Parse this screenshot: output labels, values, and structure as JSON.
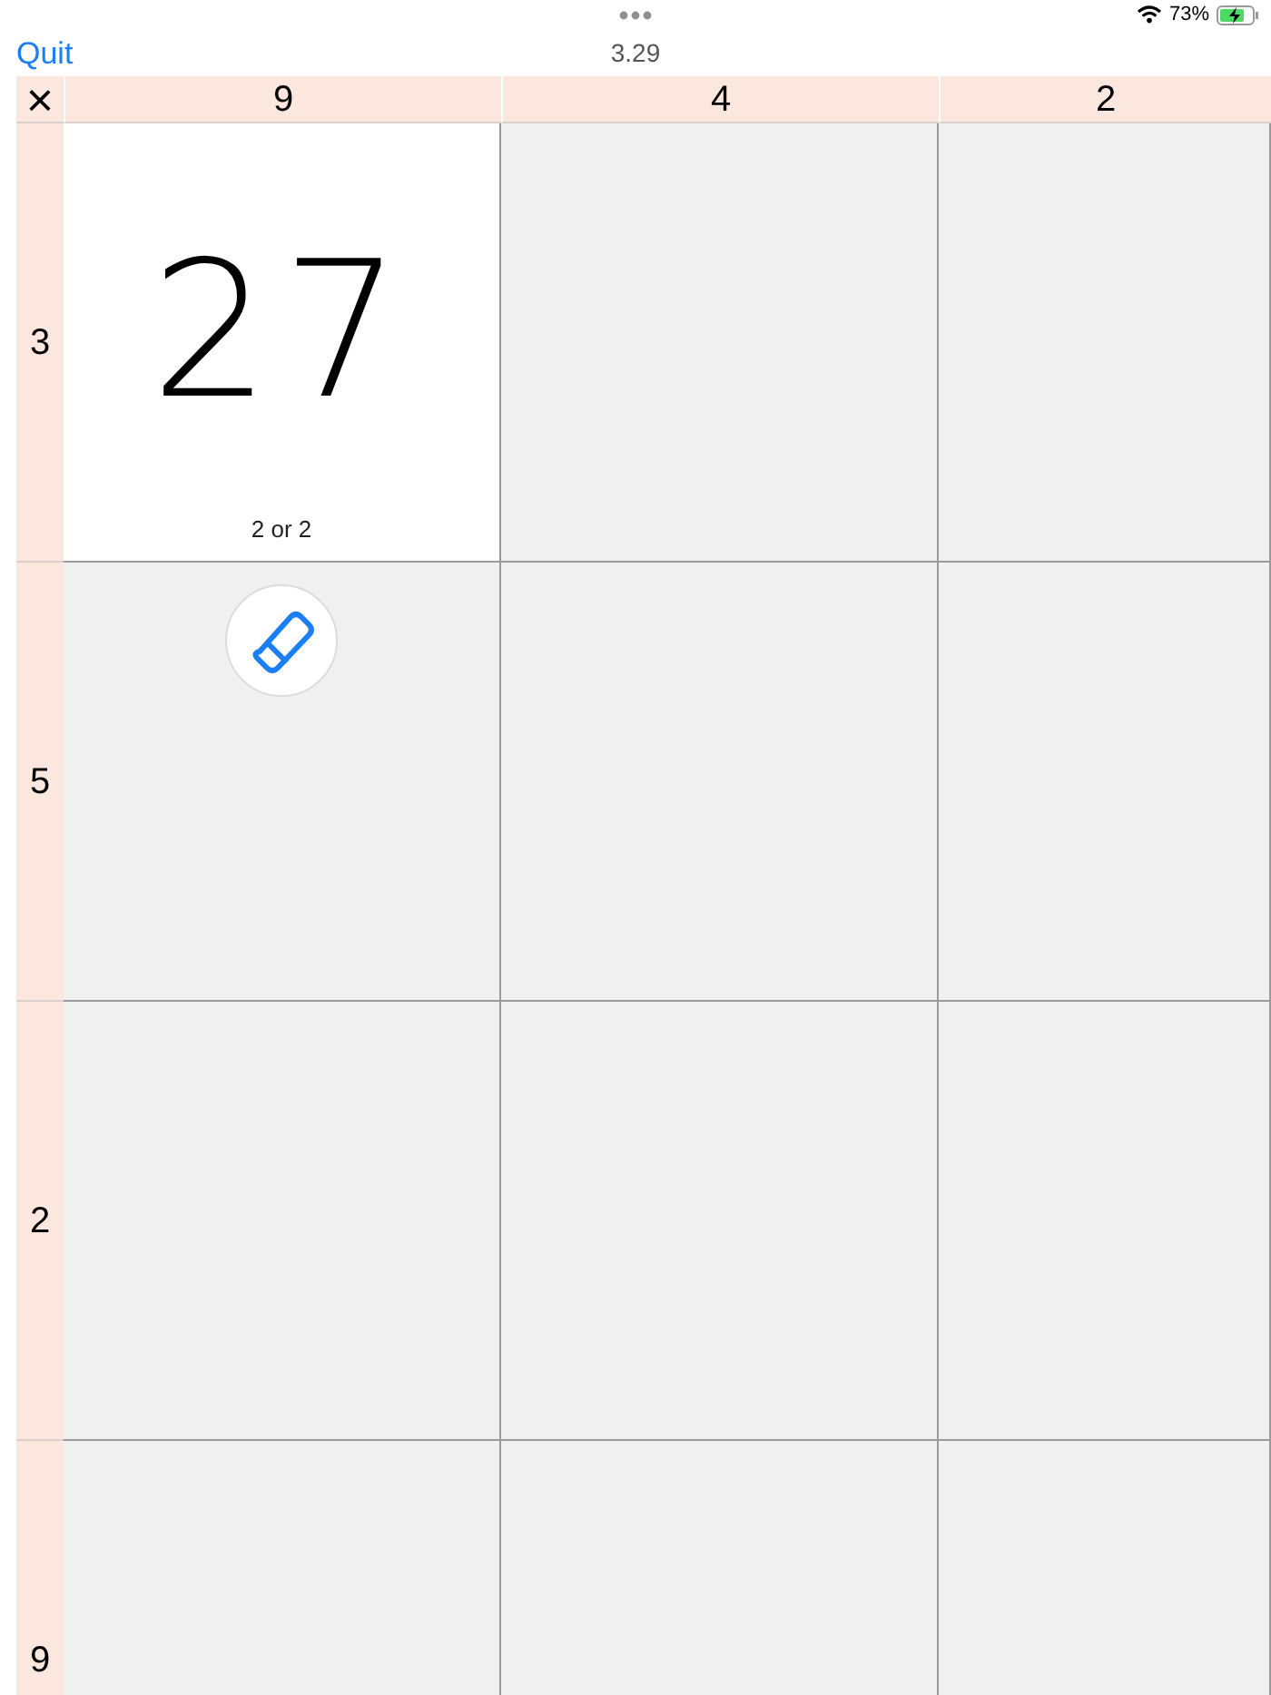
{
  "status_bar": {
    "battery_percent": "73%"
  },
  "nav": {
    "quit": "Quit",
    "title": "3.29"
  },
  "grid": {
    "corner": "×",
    "columns": [
      "9",
      "4",
      "2"
    ],
    "rows": [
      {
        "label": "3",
        "cells": [
          {
            "kind": "answer",
            "ink": "27",
            "hint": "2 or 2"
          },
          {
            "kind": "blank"
          },
          {
            "kind": "blank"
          }
        ]
      },
      {
        "label": "5",
        "cells": [
          {
            "kind": "eraser"
          },
          {
            "kind": "blank"
          },
          {
            "kind": "blank"
          }
        ]
      },
      {
        "label": "2",
        "cells": [
          {
            "kind": "blank"
          },
          {
            "kind": "blank"
          },
          {
            "kind": "blank"
          }
        ]
      },
      {
        "label": "9",
        "cells": [
          {
            "kind": "blank"
          },
          {
            "kind": "blank"
          },
          {
            "kind": "blank"
          }
        ]
      }
    ]
  }
}
